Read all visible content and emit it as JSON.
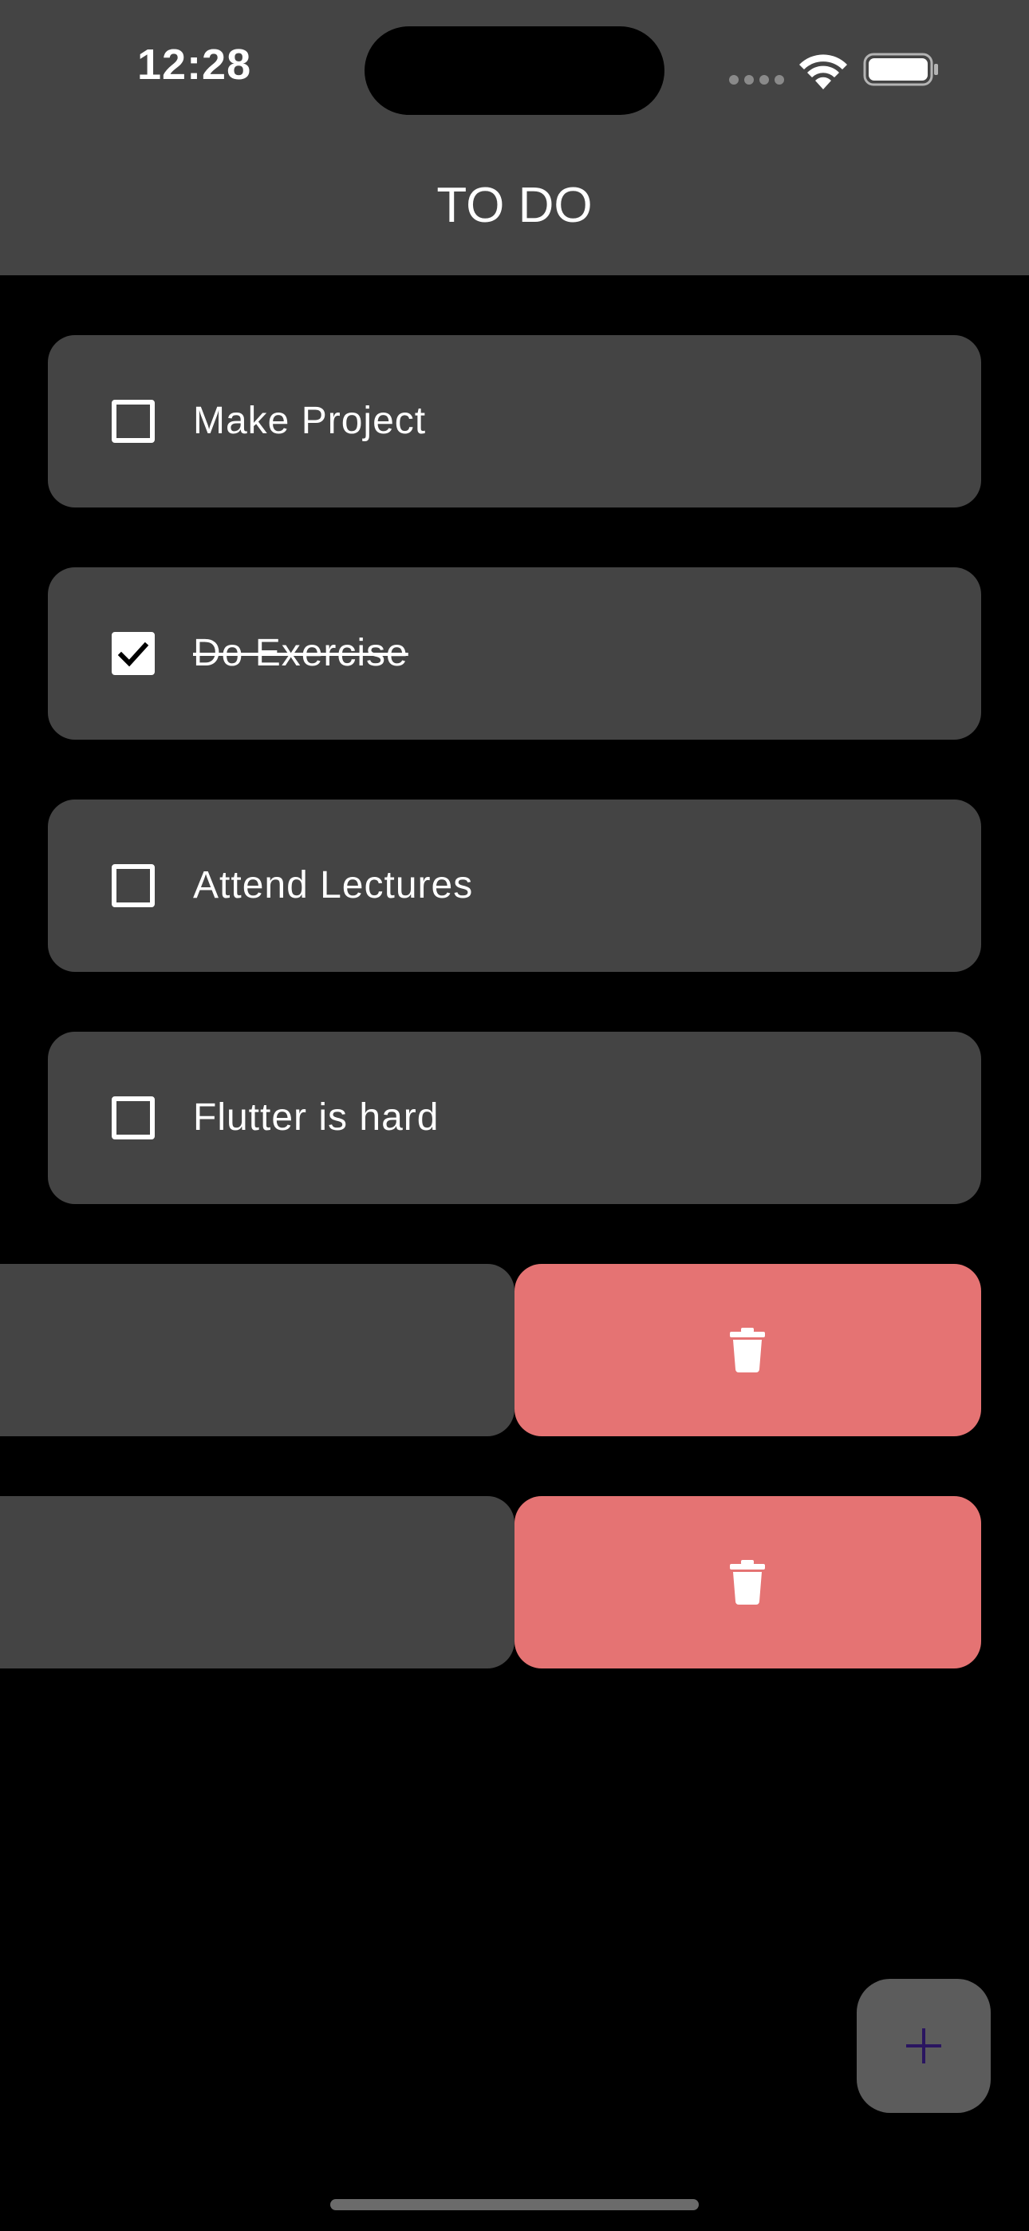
{
  "status_bar": {
    "time": "12:28"
  },
  "header": {
    "title": "TO DO"
  },
  "todos": [
    {
      "label": "Make Project",
      "checked": false
    },
    {
      "label": "Do Exercise",
      "checked": true
    },
    {
      "label": "Attend Lectures",
      "checked": false
    },
    {
      "label": "Flutter is hard",
      "checked": false
    }
  ],
  "swiped_items": [
    {
      "action_icon": "trash-icon"
    },
    {
      "action_icon": "trash-icon"
    }
  ],
  "fab": {
    "icon": "plus-icon"
  },
  "colors": {
    "background": "#000000",
    "surface": "#444444",
    "delete": "#e57373",
    "fab": "#5c5c5c",
    "fab_icon": "#2a1560"
  }
}
